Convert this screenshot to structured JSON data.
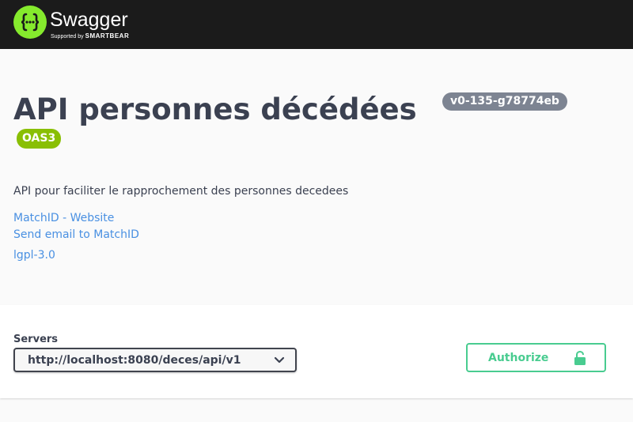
{
  "topbar": {
    "brand": "Swagger",
    "tagline_prefix": "Supported by",
    "tagline_company": "SMARTBEAR",
    "trademark": ".",
    "colors": {
      "background": "#1b1b1b",
      "logo": "#85ea2d"
    },
    "logo_icon": "swagger-braces-icon"
  },
  "info": {
    "title": "API personnes décédées",
    "version": "v0-135-g78774eb",
    "spec_badge": "OAS3",
    "description": "API pour faciliter le rapprochement des personnes decedees",
    "links": {
      "website": "MatchID - Website",
      "email": "Send email to MatchID",
      "license": "lgpl-3.0"
    },
    "colors": {
      "version_badge": "#7d8492",
      "spec_badge": "#89bf04",
      "link": "#4990e2"
    }
  },
  "servers": {
    "label": "Servers",
    "selected": "http://localhost:8080/deces/api/v1",
    "chevron_icon": "chevron-down-icon"
  },
  "authorize": {
    "label": "Authorize",
    "icon": "lock-icon",
    "color": "#49cc90"
  }
}
